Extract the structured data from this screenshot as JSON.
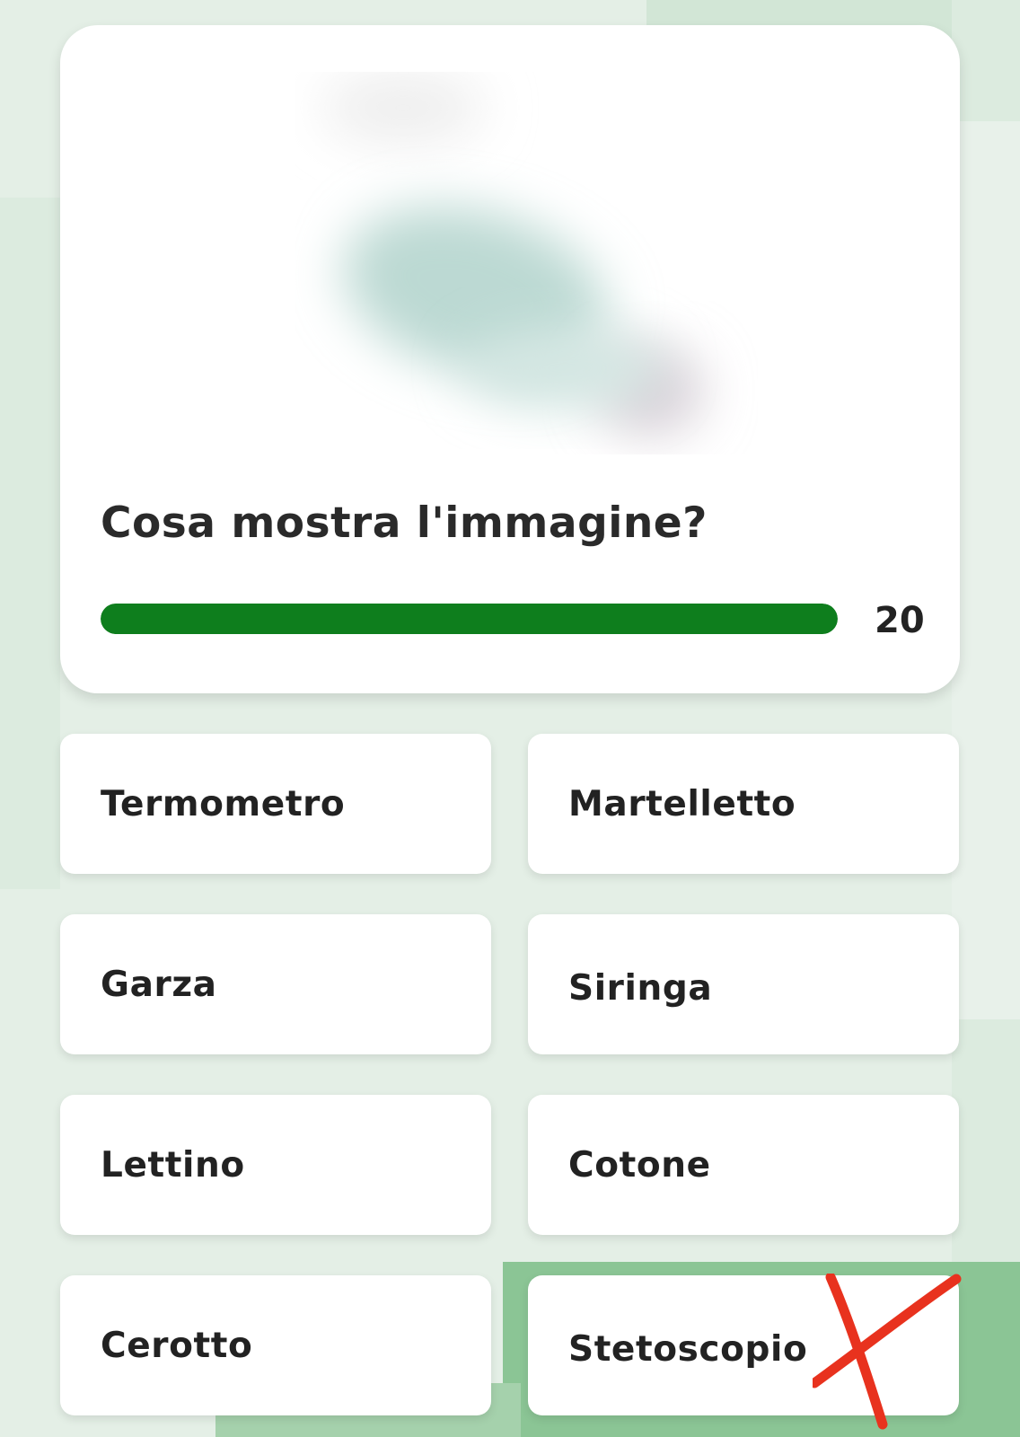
{
  "question": {
    "text": "Cosa mostra l'immagine?",
    "image_icon": "blurred-image",
    "timer_value": "20",
    "timer_progress": 1.0,
    "timer_color": "#0e7e1d"
  },
  "answers": [
    {
      "label": "Termometro"
    },
    {
      "label": "Martelletto"
    },
    {
      "label": "Garza"
    },
    {
      "label": "Siringa"
    },
    {
      "label": "Lettino"
    },
    {
      "label": "Cotone"
    },
    {
      "label": "Cerotto"
    },
    {
      "label": "Stetoscopio",
      "marked": "cross-mark-icon",
      "mark_color": "#e8321e"
    }
  ],
  "colors": {
    "background": "#e4efe6",
    "accent": "#0e7e1d",
    "mark": "#e8321e"
  }
}
